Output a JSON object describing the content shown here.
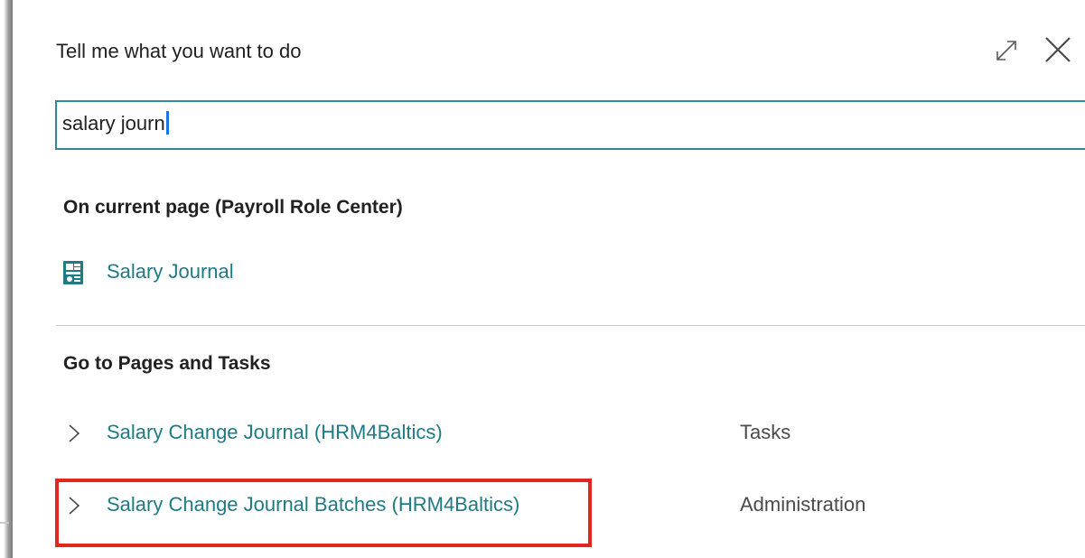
{
  "dialog": {
    "title": "Tell me what you want to do"
  },
  "search": {
    "value": "salary journ",
    "placeholder": ""
  },
  "current_page": {
    "heading": "On current page (Payroll Role Center)",
    "items": [
      {
        "label": "Salary Journal",
        "icon": "journal-icon"
      }
    ]
  },
  "pages_tasks": {
    "heading": "Go to Pages and Tasks",
    "items": [
      {
        "label": "Salary Change Journal (HRM4Baltics)",
        "category": "Tasks"
      },
      {
        "label": "Salary Change Journal Batches (HRM4Baltics)",
        "category": "Administration"
      }
    ]
  },
  "icons": {
    "expand": "expand-icon",
    "close": "close-icon",
    "chevron": "chevron-right-icon"
  },
  "colors": {
    "link": "#1e7a84",
    "search_border": "#2f8a93",
    "highlight": "#e3261e"
  }
}
